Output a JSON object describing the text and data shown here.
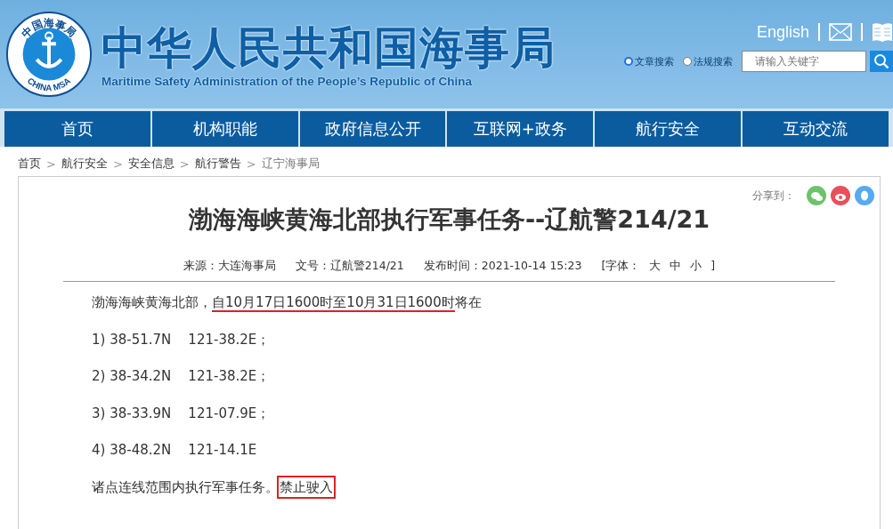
{
  "header": {
    "logo": {
      "ring_top": "中国海事局",
      "ring_bottom": "CHINA MSA"
    },
    "title": "中华人民共和国海事局",
    "subtitle": "Maritime Safety Administration of the People’s Republic of China",
    "english_link": "English",
    "search_scopes": [
      {
        "label": "文章搜索",
        "selected": true
      },
      {
        "label": "法规搜索",
        "selected": false
      }
    ],
    "search": {
      "placeholder": "请输入关键字"
    }
  },
  "nav": [
    {
      "label": "首页"
    },
    {
      "label": "机构职能"
    },
    {
      "label": "政府信息公开"
    },
    {
      "label": "互联网+政务"
    },
    {
      "label": "航行安全"
    },
    {
      "label": "互动交流"
    }
  ],
  "breadcrumb": [
    {
      "label": "首页",
      "current": false
    },
    {
      "label": "航行安全",
      "current": false
    },
    {
      "label": "安全信息",
      "current": false
    },
    {
      "label": "航行警告",
      "current": false
    },
    {
      "label": "辽宁海事局",
      "current": true
    }
  ],
  "breadcrumb_separator": ">",
  "share": {
    "label": "分享到：",
    "targets": [
      {
        "kind": "wechat",
        "color": "#6cc36a"
      },
      {
        "kind": "weibo",
        "color": "#e8505a"
      },
      {
        "kind": "qq",
        "color": "#55aaf0"
      }
    ]
  },
  "article": {
    "title": "渤海海峡黄海北部执行军事任务--辽航警214/21",
    "meta": [
      {
        "kind": "text",
        "text": "来源：大连海事局"
      },
      {
        "kind": "text",
        "text": "文号：辽航警214/21"
      },
      {
        "kind": "text",
        "text": "发布时间：2021-10-14 15:23"
      },
      {
        "kind": "fontsize",
        "label": "[字体：",
        "sizes": [
          "大",
          "中",
          "小"
        ],
        "close": "]"
      }
    ],
    "paragraphs": [
      [
        {
          "text": "渤海海峡黄海北部，",
          "underlined": false,
          "boxed": false
        },
        {
          "text": "自10月17日1600时至10月31日1600时",
          "underlined": true,
          "boxed": false
        },
        {
          "text": "将在",
          "underlined": false,
          "boxed": false
        }
      ],
      [
        {
          "text": "1) 38-51.7N    121-38.2E；",
          "underlined": false,
          "boxed": false
        }
      ],
      [
        {
          "text": "2) 38-34.2N    121-38.2E；",
          "underlined": false,
          "boxed": false
        }
      ],
      [
        {
          "text": "3) 38-33.9N    121-07.9E；",
          "underlined": false,
          "boxed": false
        }
      ],
      [
        {
          "text": "4) 38-48.2N    121-14.1E",
          "underlined": false,
          "boxed": false
        }
      ],
      [
        {
          "text": "诸点连线范围内执行军事任务。",
          "underlined": false,
          "boxed": false
        },
        {
          "text": "禁止驶入",
          "underlined": false,
          "boxed": true
        }
      ]
    ]
  }
}
